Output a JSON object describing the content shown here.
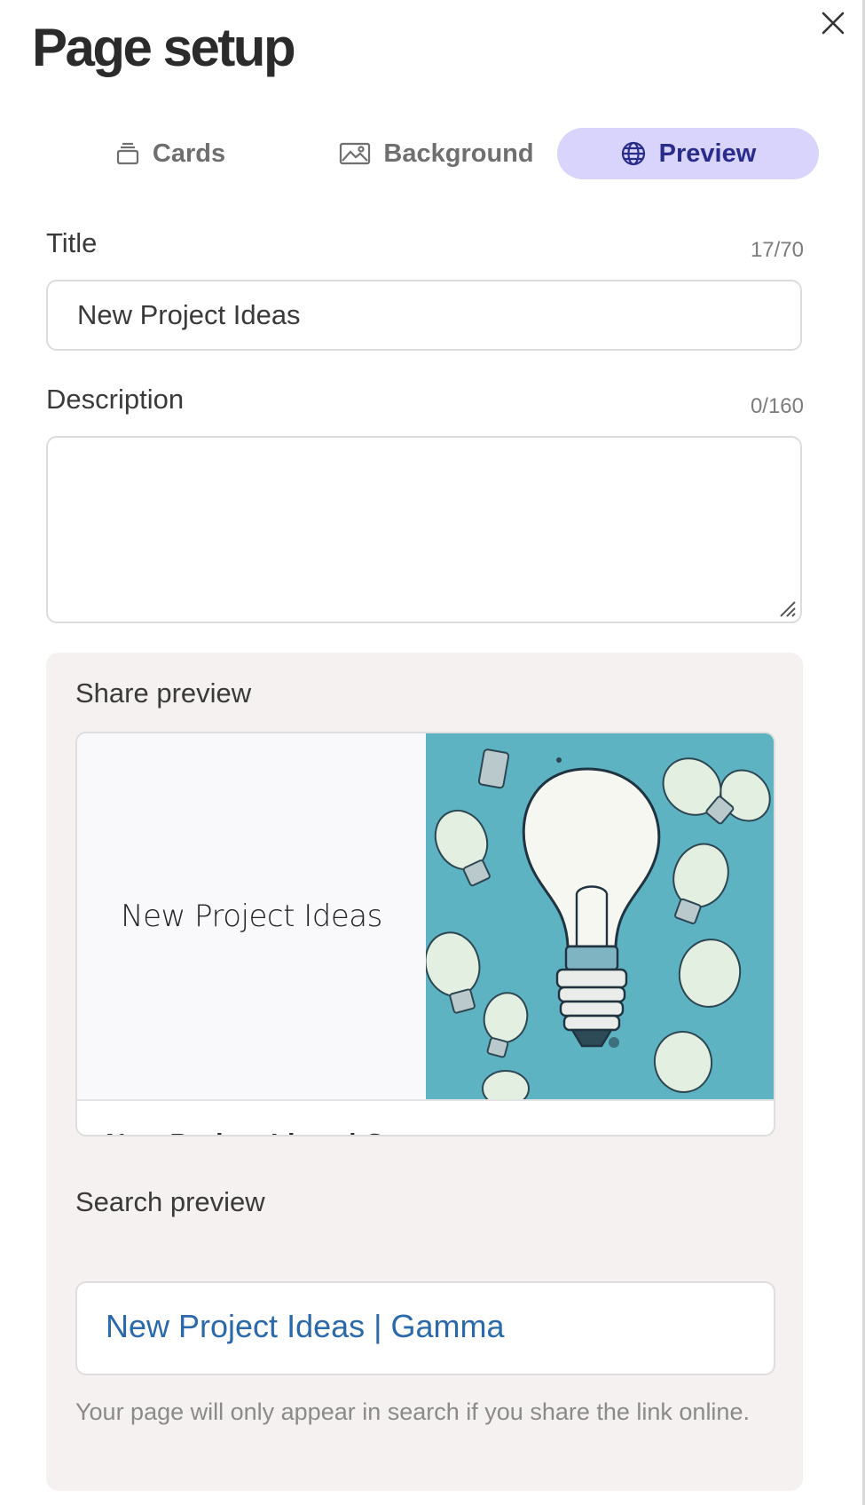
{
  "dialog": {
    "title": "Page setup",
    "close_icon": "close-icon"
  },
  "tabs": [
    {
      "label": "Cards",
      "icon": "cards-stack-icon",
      "active": false
    },
    {
      "label": "Background",
      "icon": "image-icon",
      "active": false
    },
    {
      "label": "Preview",
      "icon": "globe-icon",
      "active": true
    }
  ],
  "form": {
    "title_label": "Title",
    "title_value": "New Project Ideas",
    "title_counter": "17/70",
    "description_label": "Description",
    "description_value": "",
    "description_counter": "0/160"
  },
  "share_preview": {
    "label": "Share preview",
    "card_title": "New Project Ideas",
    "image": "lightbulb-illustration",
    "footer_text": "New Project Ideas | Gamma"
  },
  "search_preview": {
    "label": "Search preview",
    "link_text": "New Project Ideas | Gamma",
    "note": "Your page will only appear in search if you share the link online."
  },
  "colors": {
    "active_tab_bg": "#d8d4fb",
    "active_tab_text": "#2a2c8c",
    "search_link": "#2a69ab",
    "panel_bg": "#f4f1f0",
    "image_bg": "#5db3c2"
  }
}
